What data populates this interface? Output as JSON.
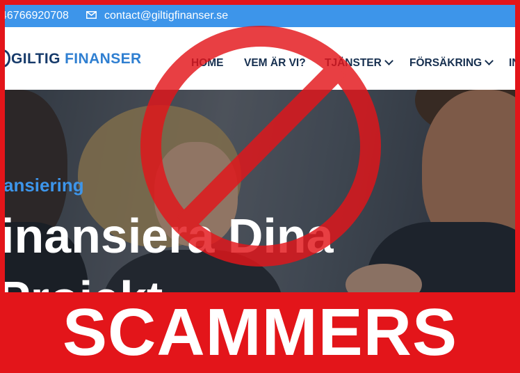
{
  "topbar": {
    "phone": "46766920708",
    "email": "contact@giltigfinanser.se",
    "mail_icon": "envelope-icon"
  },
  "logo": {
    "text_dark": "GILTIG ",
    "text_accent": "FINANSER"
  },
  "nav": {
    "items": [
      {
        "label": "HOME",
        "dropdown": false
      },
      {
        "label": "VEM ÄR VI?",
        "dropdown": false
      },
      {
        "label": "TJÄNSTER",
        "dropdown": true
      },
      {
        "label": "FÖRSÄKRING",
        "dropdown": true
      },
      {
        "label": "IN",
        "dropdown": false
      }
    ]
  },
  "hero": {
    "subtitle": "ansiering",
    "headline_line1": "inansiera Dina",
    "headline_line2": "Projekt"
  },
  "overlay": {
    "warning_text": "SCAMMERS",
    "prohibition_icon": "no-entry-icon",
    "color": "#e3151a"
  }
}
